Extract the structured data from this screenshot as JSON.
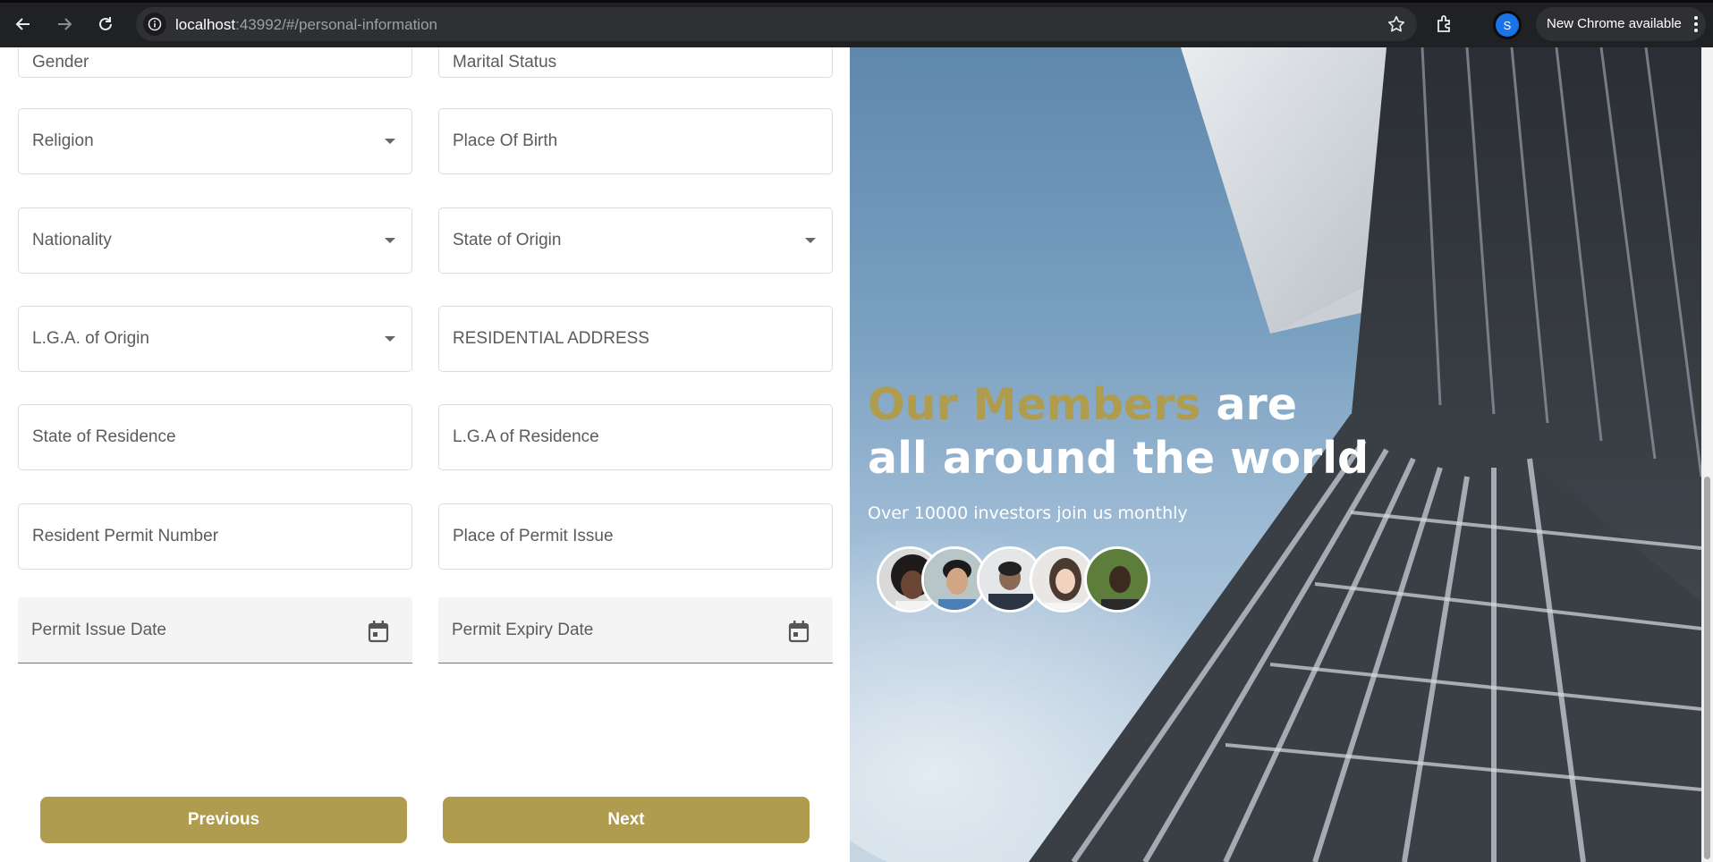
{
  "browser": {
    "url_host": "localhost",
    "url_rest": ":43992/#/personal-information",
    "profile_initial": "S",
    "update_text": "New Chrome available",
    "icons": [
      "back-arrow-icon",
      "forward-arrow-icon",
      "reload-icon",
      "site-info-icon",
      "bookmark-star-icon",
      "extensions-icon",
      "more-vert-icon"
    ]
  },
  "form": {
    "partial_fields": {
      "gender": "Gender",
      "marital_status": "Marital Status"
    },
    "religion": "Religion",
    "place_of_birth": "Place Of Birth",
    "nationality": "Nationality",
    "state_of_origin": "State of Origin",
    "lga_of_origin": "L.G.A. of Origin",
    "residential_address": "RESIDENTIAL ADDRESS",
    "state_of_residence": "State of Residence",
    "lga_of_residence": "L.G.A of Residence",
    "resident_permit_number": "Resident Permit Number",
    "place_of_permit_issue": "Place of Permit Issue",
    "permit_issue_date": "Permit Issue Date",
    "permit_expiry_date": "Permit Expiry Date",
    "previous_label": "Previous",
    "next_label": "Next"
  },
  "hero": {
    "headline_highlight": "Our Members",
    "headline_rest_1": "are",
    "headline_line_2": "all around the world",
    "subtitle": "Over 10000 investors join us monthly",
    "avatar_count": 5
  },
  "colors": {
    "accent": "#b09c4f",
    "chrome_bg": "#202124",
    "sky": "#7aa0c0"
  }
}
